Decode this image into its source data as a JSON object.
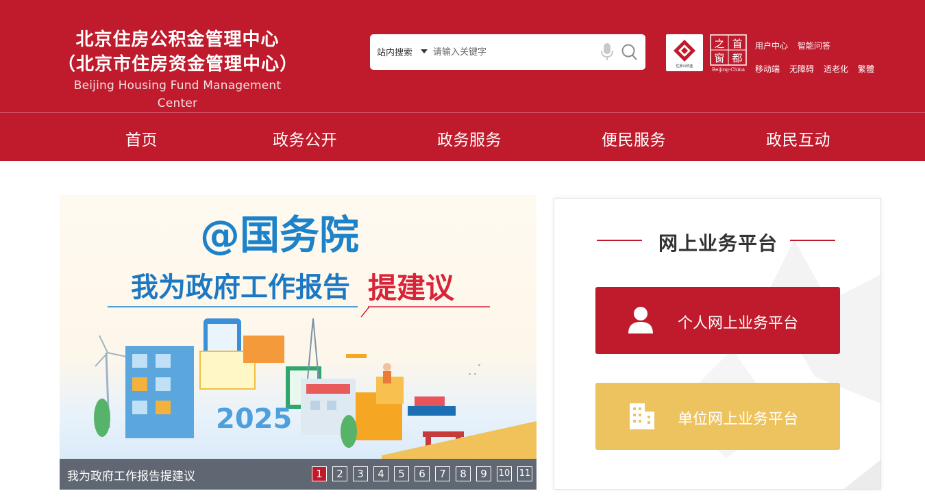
{
  "header": {
    "title_line1": "北京住房公积金管理中心",
    "title_line2": "（北京市住房资金管理中心）",
    "title_en": "Beijing Housing Fund Management Center",
    "search": {
      "scope_label": "站内搜索",
      "placeholder": "请输入关键字"
    },
    "badge1_caption": "住房公积金",
    "badge2_chars": [
      "之",
      "首",
      "窗",
      "都"
    ],
    "badge2_caption": "Beijing-China",
    "links": {
      "user_center": "用户中心",
      "smart_qa": "智能问答",
      "mobile": "移动端",
      "accessible": "无障碍",
      "elderly": "适老化",
      "traditional": "繁體"
    }
  },
  "nav": {
    "items": [
      "首页",
      "政务公开",
      "政务服务",
      "便民服务",
      "政民互动"
    ]
  },
  "banner": {
    "caption": "我为政府工作报告提建议",
    "pages": [
      "1",
      "2",
      "3",
      "4",
      "5",
      "6",
      "7",
      "8",
      "9",
      "10",
      "11"
    ],
    "active_page": "1",
    "art": {
      "headline": "@国务院",
      "subline": "我为政府工作报告",
      "subline_emph": "提建议",
      "year": "2025"
    }
  },
  "panel": {
    "title": "网上业务平台",
    "personal_label": "个人网上业务平台",
    "unit_label": "单位网上业务平台"
  },
  "colors": {
    "brand_red": "#bf1b2c",
    "gold": "#ecc35f"
  }
}
